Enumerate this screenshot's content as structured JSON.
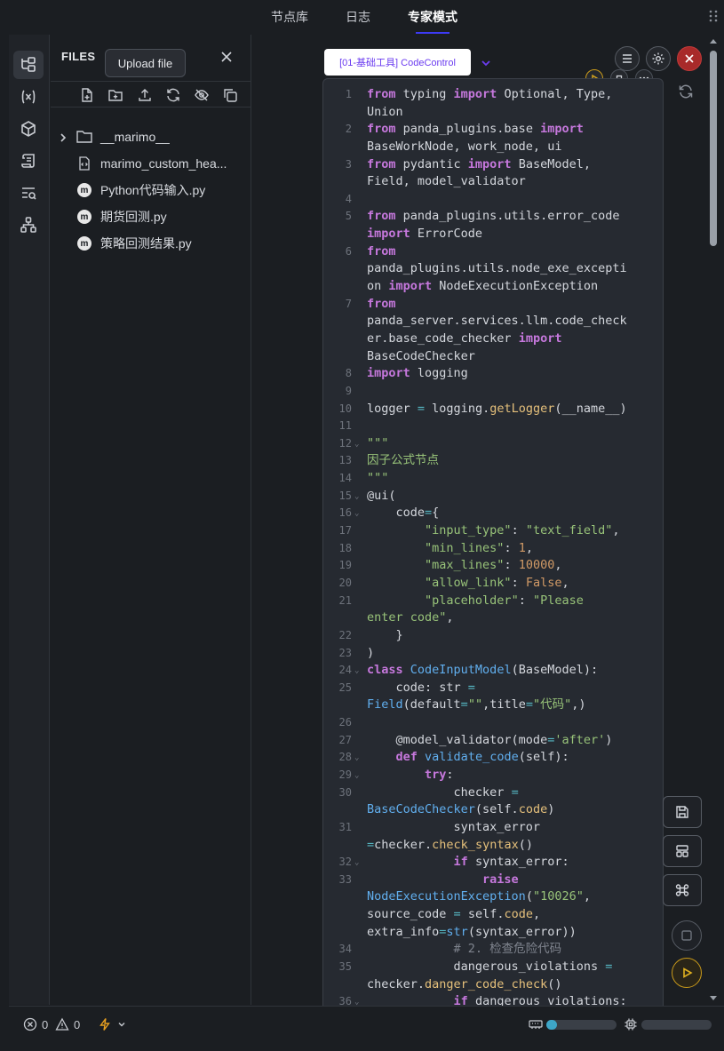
{
  "top_tabs": [
    {
      "label": "节点库",
      "active": false
    },
    {
      "label": "日志",
      "active": false
    },
    {
      "label": "专家模式",
      "active": true
    }
  ],
  "files_panel": {
    "title": "FILES",
    "tooltip": "Upload file",
    "items": [
      {
        "name": "__marimo__",
        "type": "folder",
        "icon": "folder-icon"
      },
      {
        "name": "marimo_custom_hea...",
        "type": "file",
        "icon": "code-file-icon"
      },
      {
        "name": "Python代码输入.py",
        "type": "notebook",
        "icon": "marimo-icon"
      },
      {
        "name": "期货回测.py",
        "type": "notebook",
        "icon": "marimo-icon"
      },
      {
        "name": "策略回测结果.py",
        "type": "notebook",
        "icon": "marimo-icon"
      }
    ]
  },
  "cell": {
    "tag": "[01-基础工具] CodeControl"
  },
  "status": {
    "errors": "0",
    "warnings": "0",
    "memory_fraction": 0.15,
    "cpu_fraction": 0.0
  },
  "colors": {
    "accent": "#3d3af5",
    "tag_text": "#6b3cf0",
    "run_yellow": "#c99a1a",
    "close_red": "#a82a2a",
    "progress": "#3ea6c8"
  },
  "code_lines": [
    {
      "n": "1",
      "h": "<span class='kw'>from</span> typing <span class='kw'>import</span> Optional, Type,"
    },
    {
      "n": "",
      "h": "Union"
    },
    {
      "n": "2",
      "h": "<span class='kw'>from</span> panda_plugins.base <span class='kw'>import</span>"
    },
    {
      "n": "",
      "h": "BaseWorkNode, work_node, ui"
    },
    {
      "n": "3",
      "h": "<span class='kw'>from</span> pydantic <span class='kw'>import</span> BaseModel,"
    },
    {
      "n": "",
      "h": "Field, model_validator"
    },
    {
      "n": "4",
      "h": ""
    },
    {
      "n": "5",
      "h": "<span class='kw'>from</span> panda_plugins.utils.error_code"
    },
    {
      "n": "",
      "h": "<span class='kw'>import</span> ErrorCode"
    },
    {
      "n": "6",
      "h": "<span class='kw'>from</span>"
    },
    {
      "n": "",
      "h": "panda_plugins.utils.node_exe_excepti"
    },
    {
      "n": "",
      "h": "on <span class='kw'>import</span> NodeExecutionException"
    },
    {
      "n": "7",
      "h": "<span class='kw'>from</span>"
    },
    {
      "n": "",
      "h": "panda_server.services.llm.code_check"
    },
    {
      "n": "",
      "h": "er.base_code_checker <span class='kw'>import</span>"
    },
    {
      "n": "",
      "h": "BaseCodeChecker"
    },
    {
      "n": "8",
      "h": "<span class='kw'>import</span> logging"
    },
    {
      "n": "9",
      "h": ""
    },
    {
      "n": "10",
      "h": "logger <span class='op'>=</span> logging.<span class='at'>getLogger</span>(__name__)"
    },
    {
      "n": "11",
      "h": ""
    },
    {
      "n": "12",
      "f": true,
      "h": "<span class='st'>\"\"\"</span>"
    },
    {
      "n": "13",
      "h": "<span class='st'>因子公式节点</span>"
    },
    {
      "n": "14",
      "h": "<span class='st'>\"\"\"</span>"
    },
    {
      "n": "15",
      "f": true,
      "h": "@ui("
    },
    {
      "n": "16",
      "f": true,
      "h": "    code<span class='op'>=</span>{"
    },
    {
      "n": "17",
      "h": "        <span class='st'>\"input_type\"</span>: <span class='st'>\"text_field\"</span>,"
    },
    {
      "n": "18",
      "h": "        <span class='st'>\"min_lines\"</span>: <span class='nm'>1</span>,"
    },
    {
      "n": "19",
      "h": "        <span class='st'>\"max_lines\"</span>: <span class='nm'>10000</span>,"
    },
    {
      "n": "20",
      "h": "        <span class='st'>\"allow_link\"</span>: <span class='nm'>False</span>,"
    },
    {
      "n": "21",
      "h": "        <span class='st'>\"placeholder\"</span>: <span class='st'>\"Please</span>"
    },
    {
      "n": "",
      "h": "<span class='st'>enter code\"</span>,"
    },
    {
      "n": "22",
      "h": "    }"
    },
    {
      "n": "23",
      "h": ")"
    },
    {
      "n": "24",
      "f": true,
      "h": "<span class='kw'>class</span> <span class='fn'>CodeInputModel</span>(BaseModel):"
    },
    {
      "n": "25",
      "h": "    code: str <span class='op'>=</span>"
    },
    {
      "n": "",
      "h": "<span class='fn'>Field</span>(default<span class='op'>=</span><span class='st'>\"\"</span>,title<span class='op'>=</span><span class='st'>\"代码\"</span>,)"
    },
    {
      "n": "26",
      "h": ""
    },
    {
      "n": "27",
      "h": "    @model_validator(mode<span class='op'>=</span><span class='st'>'after'</span>)"
    },
    {
      "n": "28",
      "f": true,
      "h": "    <span class='kw'>def</span> <span class='fn'>validate_code</span>(self):"
    },
    {
      "n": "29",
      "f": true,
      "h": "        <span class='kw'>try</span>:"
    },
    {
      "n": "30",
      "h": "            checker <span class='op'>=</span>"
    },
    {
      "n": "",
      "h": "<span class='fn'>BaseCodeChecker</span>(self.<span class='at'>code</span>)"
    },
    {
      "n": "31",
      "h": "            syntax_error"
    },
    {
      "n": "",
      "h": "<span class='op'>=</span>checker.<span class='at'>check_syntax</span>()"
    },
    {
      "n": "32",
      "f": true,
      "h": "            <span class='kw'>if</span> syntax_error:"
    },
    {
      "n": "33",
      "h": "                <span class='kw'>raise</span>"
    },
    {
      "n": "",
      "h": "<span class='fn'>NodeExecutionException</span>(<span class='st'>\"10026\"</span>,"
    },
    {
      "n": "",
      "h": "source_code <span class='op'>=</span> self.<span class='at'>code</span>,"
    },
    {
      "n": "",
      "h": "extra_info<span class='op'>=</span><span class='fn'>str</span>(syntax_error))"
    },
    {
      "n": "34",
      "h": "            <span class='cm'># 2. 检查危险代码</span>"
    },
    {
      "n": "35",
      "h": "            dangerous_violations <span class='op'>=</span>"
    },
    {
      "n": "",
      "h": "checker.<span class='at'>danger_code_check</span>()"
    },
    {
      "n": "36",
      "f": true,
      "h": "            <span class='kw'>if</span> dangerous_violations:"
    }
  ]
}
